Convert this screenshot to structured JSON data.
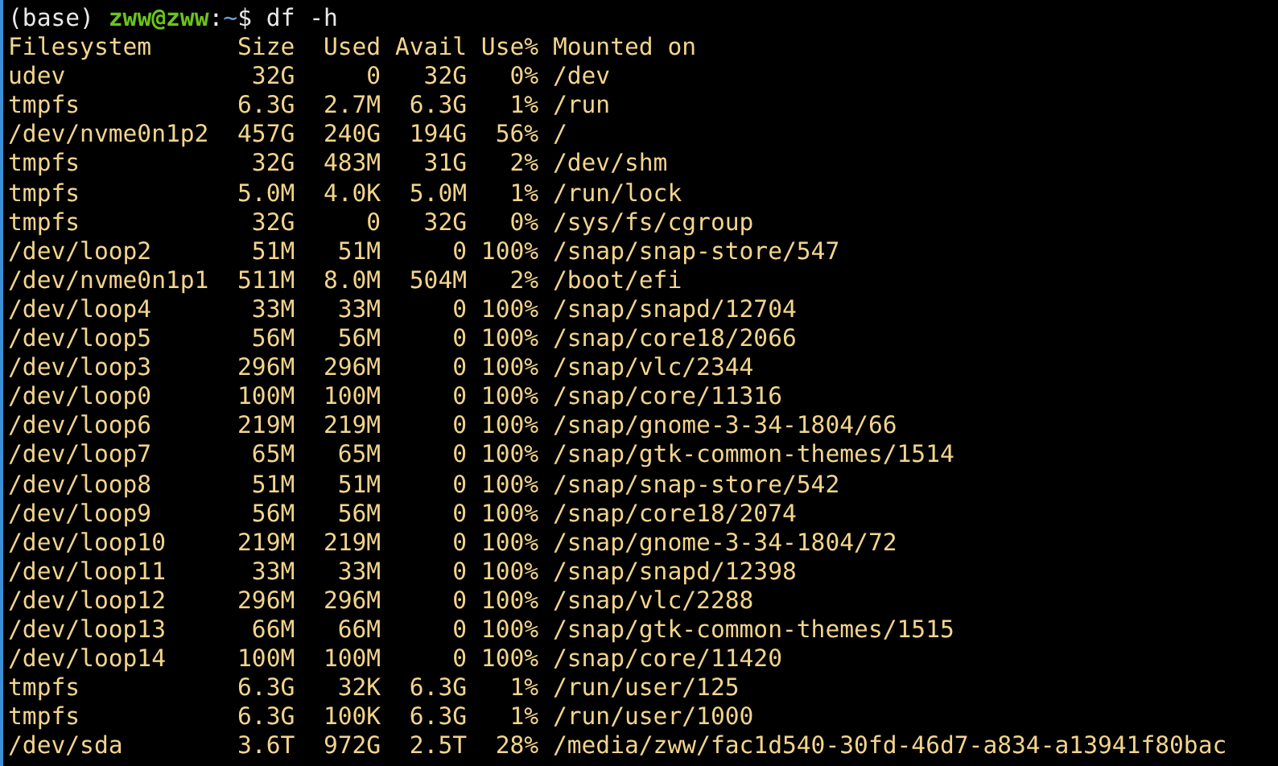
{
  "prompt": {
    "env": "(base)",
    "user_host": "zww@zww",
    "separator": ":",
    "cwd": "~",
    "symbol": "$",
    "command": "df -h"
  },
  "table": {
    "columns": [
      "Filesystem",
      "Size",
      "Used",
      "Avail",
      "Use%",
      "Mounted on"
    ],
    "rows": [
      [
        "udev",
        "32G",
        "0",
        "32G",
        "0%",
        "/dev"
      ],
      [
        "tmpfs",
        "6.3G",
        "2.7M",
        "6.3G",
        "1%",
        "/run"
      ],
      [
        "/dev/nvme0n1p2",
        "457G",
        "240G",
        "194G",
        "56%",
        "/"
      ],
      [
        "tmpfs",
        "32G",
        "483M",
        "31G",
        "2%",
        "/dev/shm"
      ],
      [
        "tmpfs",
        "5.0M",
        "4.0K",
        "5.0M",
        "1%",
        "/run/lock"
      ],
      [
        "tmpfs",
        "32G",
        "0",
        "32G",
        "0%",
        "/sys/fs/cgroup"
      ],
      [
        "/dev/loop2",
        "51M",
        "51M",
        "0",
        "100%",
        "/snap/snap-store/547"
      ],
      [
        "/dev/nvme0n1p1",
        "511M",
        "8.0M",
        "504M",
        "2%",
        "/boot/efi"
      ],
      [
        "/dev/loop4",
        "33M",
        "33M",
        "0",
        "100%",
        "/snap/snapd/12704"
      ],
      [
        "/dev/loop5",
        "56M",
        "56M",
        "0",
        "100%",
        "/snap/core18/2066"
      ],
      [
        "/dev/loop3",
        "296M",
        "296M",
        "0",
        "100%",
        "/snap/vlc/2344"
      ],
      [
        "/dev/loop0",
        "100M",
        "100M",
        "0",
        "100%",
        "/snap/core/11316"
      ],
      [
        "/dev/loop6",
        "219M",
        "219M",
        "0",
        "100%",
        "/snap/gnome-3-34-1804/66"
      ],
      [
        "/dev/loop7",
        "65M",
        "65M",
        "0",
        "100%",
        "/snap/gtk-common-themes/1514"
      ],
      [
        "/dev/loop8",
        "51M",
        "51M",
        "0",
        "100%",
        "/snap/snap-store/542"
      ],
      [
        "/dev/loop9",
        "56M",
        "56M",
        "0",
        "100%",
        "/snap/core18/2074"
      ],
      [
        "/dev/loop10",
        "219M",
        "219M",
        "0",
        "100%",
        "/snap/gnome-3-34-1804/72"
      ],
      [
        "/dev/loop11",
        "33M",
        "33M",
        "0",
        "100%",
        "/snap/snapd/12398"
      ],
      [
        "/dev/loop12",
        "296M",
        "296M",
        "0",
        "100%",
        "/snap/vlc/2288"
      ],
      [
        "/dev/loop13",
        "66M",
        "66M",
        "0",
        "100%",
        "/snap/gtk-common-themes/1515"
      ],
      [
        "/dev/loop14",
        "100M",
        "100M",
        "0",
        "100%",
        "/snap/core/11420"
      ],
      [
        "tmpfs",
        "6.3G",
        "32K",
        "6.3G",
        "1%",
        "/run/user/125"
      ],
      [
        "tmpfs",
        "6.3G",
        "100K",
        "6.3G",
        "1%",
        "/run/user/1000"
      ],
      [
        "/dev/sda",
        "3.6T",
        "972G",
        "2.5T",
        "28%",
        "/media/zww/fac1d540-30fd-46d7-a834-a13941f80bac"
      ]
    ]
  }
}
